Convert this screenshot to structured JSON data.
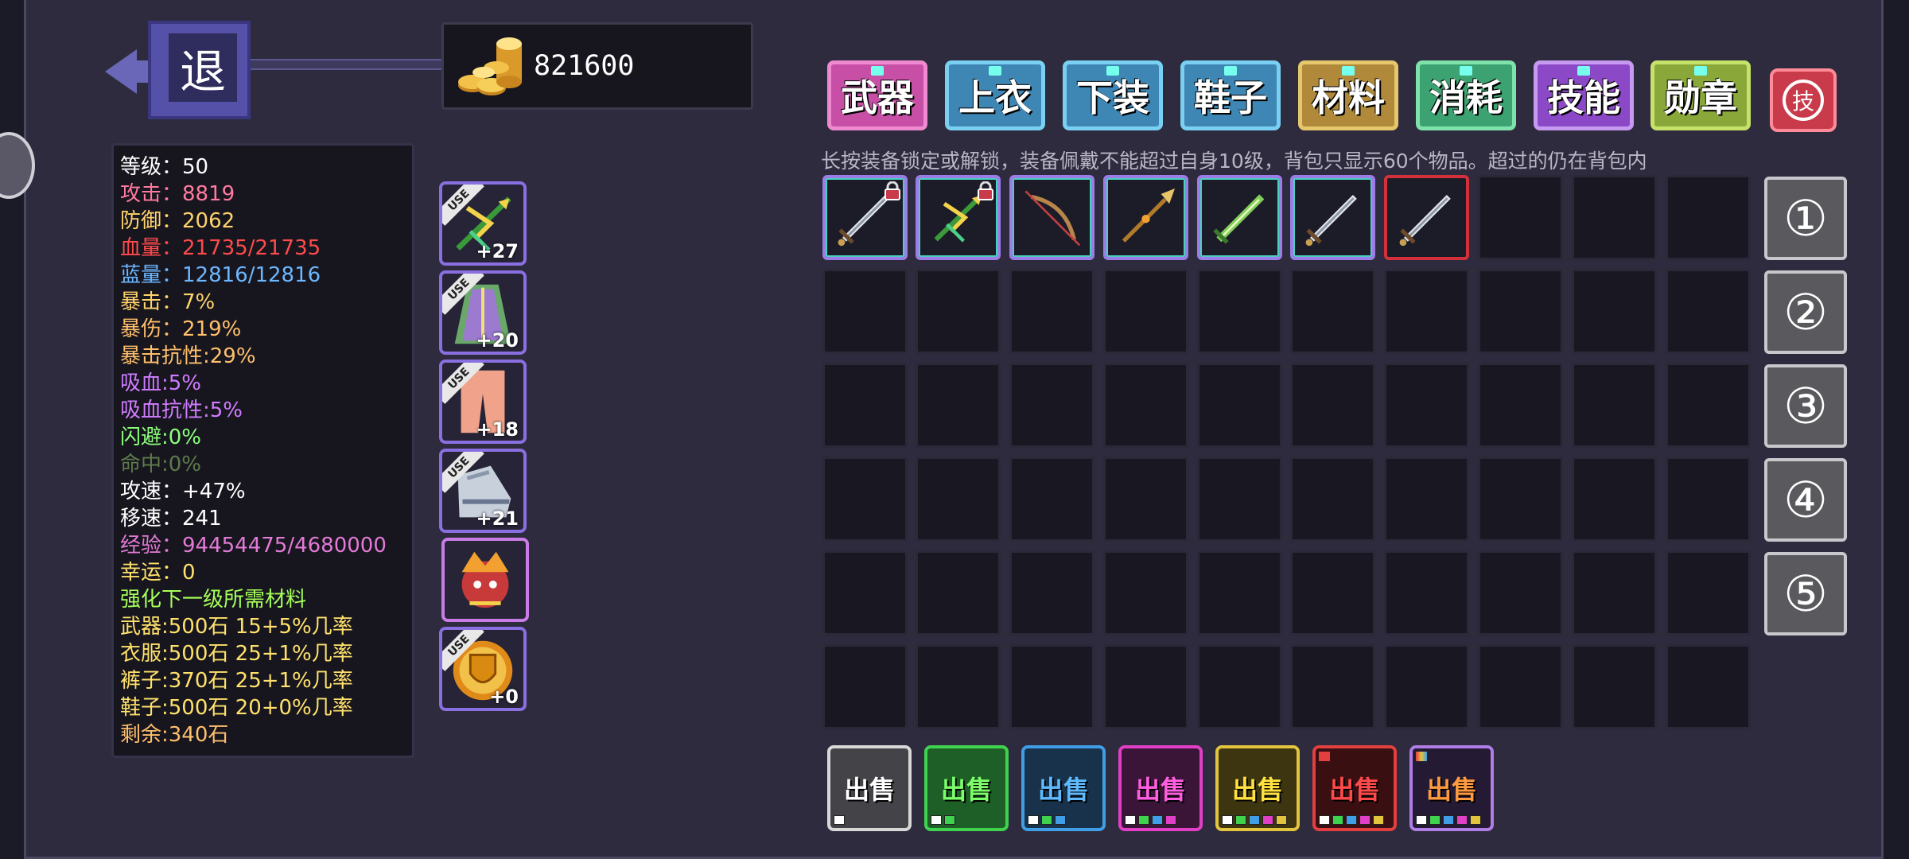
{
  "back_label": "退",
  "gold": "821600",
  "tabs": [
    {
      "label": "武器",
      "bg": "#c74fa6",
      "border": "#f08ad0"
    },
    {
      "label": "上衣",
      "bg": "#3e86b4",
      "border": "#7ad0f3"
    },
    {
      "label": "下装",
      "bg": "#3e86b4",
      "border": "#7ad0f3"
    },
    {
      "label": "鞋子",
      "bg": "#3e86b4",
      "border": "#7ad0f3"
    },
    {
      "label": "材料",
      "bg": "#b08a3a",
      "border": "#e6c76c"
    },
    {
      "label": "消耗",
      "bg": "#3da271",
      "border": "#7fe2aa"
    },
    {
      "label": "技能",
      "bg": "#8b49c8",
      "border": "#c59af0"
    },
    {
      "label": "勋章",
      "bg": "#8aa83a",
      "border": "#c7e26a"
    }
  ],
  "tech_label": "技",
  "hint": "长按装备锁定或解锁，装备佩戴不能超过自身10级，背包只显示60个物品。超过的仍在背包内",
  "stats": [
    {
      "text": "等级：50",
      "color": "#ffffff"
    },
    {
      "text": "攻击：8819",
      "color": "#ff7a9e"
    },
    {
      "text": "防御：2062",
      "color": "#ffd36b"
    },
    {
      "text": "血量：21735/21735",
      "color": "#ff4b4b"
    },
    {
      "text": "蓝量：12816/12816",
      "color": "#6cb7ff"
    },
    {
      "text": "暴击：7%",
      "color": "#ffd36b"
    },
    {
      "text": "暴伤：219%",
      "color": "#ffbf6b"
    },
    {
      "text": "暴击抗性:29%",
      "color": "#ffbf6b"
    },
    {
      "text": "吸血:5%",
      "color": "#d07cff"
    },
    {
      "text": "吸血抗性:5%",
      "color": "#d07cff"
    },
    {
      "text": "闪避:0%",
      "color": "#8bff7a"
    },
    {
      "text": "命中:0%",
      "color": "#5d7a4a"
    },
    {
      "text": "攻速：+47%",
      "color": "#ffffff"
    },
    {
      "text": "移速：241",
      "color": "#ffffff"
    },
    {
      "text": "经验：94454475/4680000",
      "color": "#e27ad6"
    },
    {
      "text": "幸运：0",
      "color": "#ffe16b"
    },
    {
      "text": "强化下一级所需材料",
      "color": "#a6ff5a"
    },
    {
      "text": "武器:500石 15+5%几率",
      "color": "#ffe16b"
    },
    {
      "text": "衣服:500石 25+1%几率",
      "color": "#ffe16b"
    },
    {
      "text": "裤子:370石 25+1%几率",
      "color": "#ffe16b"
    },
    {
      "text": "鞋子:500石 20+0%几率",
      "color": "#ffe16b"
    },
    {
      "text": "剩余:340石",
      "color": "#ffbf6b"
    }
  ],
  "equipped": [
    {
      "name": "weapon",
      "badge": "USE",
      "plus": "+27",
      "icon": "crossbow-icon"
    },
    {
      "name": "armor",
      "badge": "USE",
      "plus": "+20",
      "icon": "robe-icon"
    },
    {
      "name": "pants",
      "badge": "USE",
      "plus": "+18",
      "icon": "pants-icon"
    },
    {
      "name": "boots",
      "badge": "USE",
      "plus": "+21",
      "icon": "boots-icon"
    },
    {
      "name": "pet",
      "badge": "",
      "plus": "",
      "icon": "pet-icon"
    },
    {
      "name": "medal",
      "badge": "USE",
      "plus": "+0",
      "icon": "shield-medal-icon"
    }
  ],
  "inventory_items": [
    {
      "icon": "sword-icon",
      "locked": true,
      "border": "#9c7ce6"
    },
    {
      "icon": "crossbow-icon",
      "locked": true,
      "border": "#9c7ce6"
    },
    {
      "icon": "bow-icon",
      "locked": false,
      "border": "#9c7ce6"
    },
    {
      "icon": "spear-icon",
      "locked": false,
      "border": "#9c7ce6"
    },
    {
      "icon": "green-sword-icon",
      "locked": false,
      "border": "#9c7ce6"
    },
    {
      "icon": "sword-icon",
      "locked": false,
      "border": "#9c7ce6"
    },
    {
      "icon": "sword-icon",
      "locked": false,
      "border": "#d4303a"
    }
  ],
  "pages": [
    "①",
    "②",
    "③",
    "④",
    "⑤"
  ],
  "sell_buttons": [
    {
      "label": "出售",
      "bg": "#444448",
      "border": "#d8d8d8",
      "color": "#ffffff",
      "dots": [
        "#ffffff"
      ]
    },
    {
      "label": "出售",
      "bg": "#1d5f26",
      "border": "#3fd24f",
      "color": "#7dff6a",
      "dots": [
        "#ffffff",
        "#3fd24f"
      ]
    },
    {
      "label": "出售",
      "bg": "#17324a",
      "border": "#3f9ee6",
      "color": "#5fb9ff",
      "dots": [
        "#ffffff",
        "#3fd24f",
        "#3f9ee6"
      ]
    },
    {
      "label": "出售",
      "bg": "#3a1538",
      "border": "#e23fc7",
      "color": "#ff5ee0",
      "dots": [
        "#ffffff",
        "#3fd24f",
        "#3f9ee6",
        "#e23fc7"
      ]
    },
    {
      "label": "出售",
      "bg": "#3d3510",
      "border": "#e2c43f",
      "color": "#ffe13f",
      "dots": [
        "#ffffff",
        "#3fd24f",
        "#3f9ee6",
        "#e23fc7",
        "#e2c43f"
      ]
    },
    {
      "label": "出售",
      "bg": "#3a0f12",
      "border": "#e23f3f",
      "color": "#ff4a4a",
      "dots": [
        "#ffffff",
        "#3fd24f",
        "#3f9ee6",
        "#e23fc7",
        "#e2c43f"
      ]
    },
    {
      "label": "出售",
      "bg": "#241a34",
      "border": "#b07ce6",
      "color": "#ff9a3f",
      "dots": [
        "#ffffff",
        "#3fd24f",
        "#3f9ee6",
        "#e23fc7",
        "#e2c43f"
      ]
    }
  ]
}
